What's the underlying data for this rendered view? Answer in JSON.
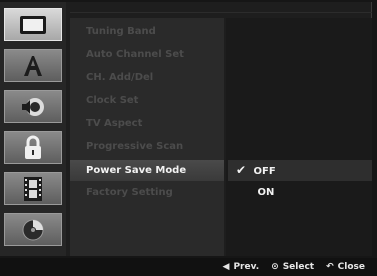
{
  "sidebar": {
    "tabs": [
      {
        "icon": "tv-screen-icon",
        "active": true
      },
      {
        "icon": "language-a-icon",
        "active": false
      },
      {
        "icon": "speaker-icon",
        "active": false
      },
      {
        "icon": "padlock-icon",
        "active": false
      },
      {
        "icon": "film-icon",
        "active": false
      },
      {
        "icon": "disc-icon",
        "active": false
      }
    ]
  },
  "menu": {
    "items": [
      {
        "label": "Tuning Band"
      },
      {
        "label": "Auto Channel Set"
      },
      {
        "label": "CH. Add/Del"
      },
      {
        "label": "Clock Set"
      },
      {
        "label": "TV Aspect"
      },
      {
        "label": "Progressive Scan"
      },
      {
        "label": "Power Save Mode"
      },
      {
        "label": "Factory Setting"
      }
    ],
    "selected_index": 6
  },
  "options": {
    "items": [
      {
        "label": "OFF",
        "checked": true
      },
      {
        "label": "ON",
        "checked": false
      }
    ],
    "check_glyph": "✔"
  },
  "footer": {
    "prev_glyph": "◀",
    "prev_label": "Prev.",
    "select_glyph": "⊙",
    "select_label": "Select",
    "close_glyph": "↶",
    "close_label": "Close"
  }
}
